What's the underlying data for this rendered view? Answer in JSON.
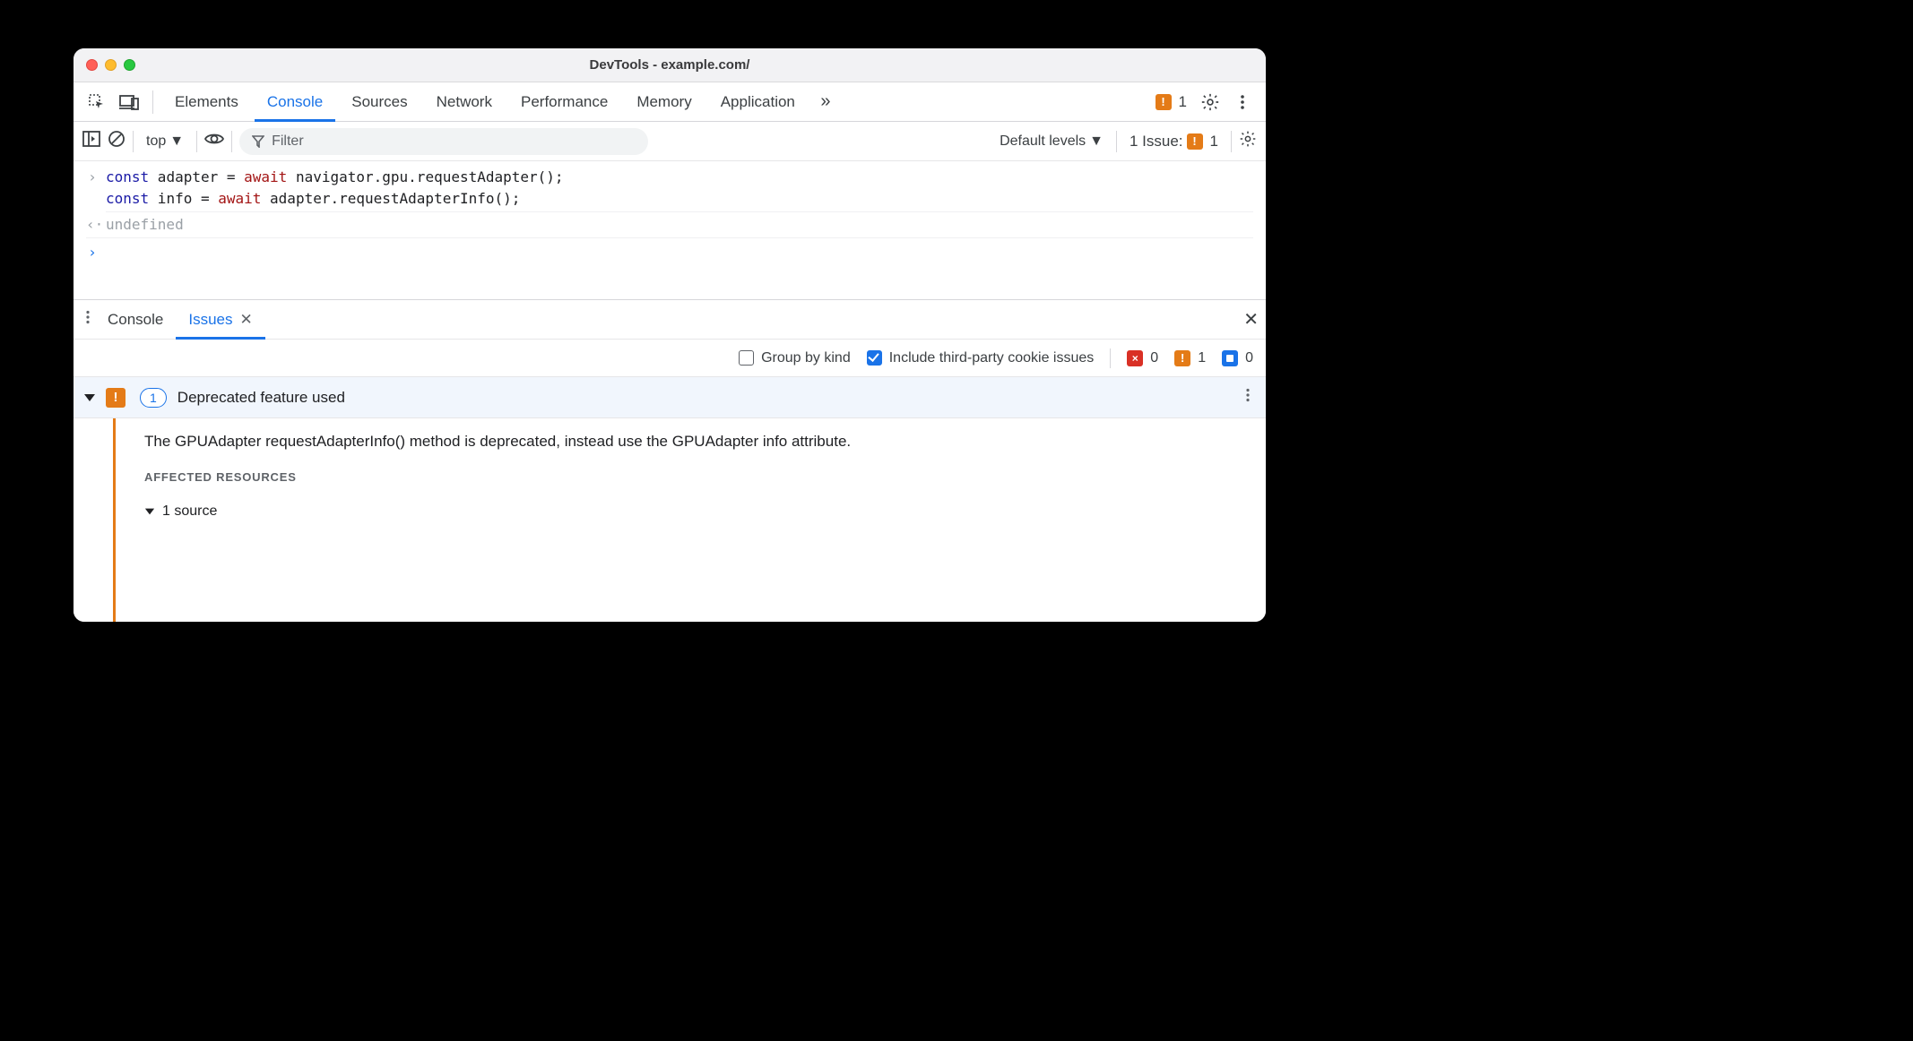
{
  "window": {
    "title": "DevTools - example.com/"
  },
  "tabs": {
    "items": [
      "Elements",
      "Console",
      "Sources",
      "Network",
      "Performance",
      "Memory",
      "Application"
    ],
    "active": "Console",
    "overflow_glyph": "»",
    "warning_count": "1"
  },
  "console_toolbar": {
    "context": "top",
    "filter_placeholder": "Filter",
    "levels_label": "Default levels",
    "issues_label": "1 Issue:",
    "issues_count": "1"
  },
  "console": {
    "input_code": "const adapter = await navigator.gpu.requestAdapter();\nconst info = await adapter.requestAdapterInfo();",
    "output_text": "undefined"
  },
  "drawer": {
    "tabs": {
      "console": "Console",
      "issues": "Issues"
    },
    "filter": {
      "group_by_kind": "Group by kind",
      "include_thirdparty": "Include third-party cookie issues",
      "errors_count": "0",
      "warnings_count": "1",
      "info_count": "0"
    },
    "issue": {
      "count": "1",
      "title": "Deprecated feature used",
      "message": "The GPUAdapter requestAdapterInfo() method is deprecated, instead use the GPUAdapter info attribute.",
      "section_label": "AFFECTED RESOURCES",
      "source_summary": "1 source"
    }
  }
}
